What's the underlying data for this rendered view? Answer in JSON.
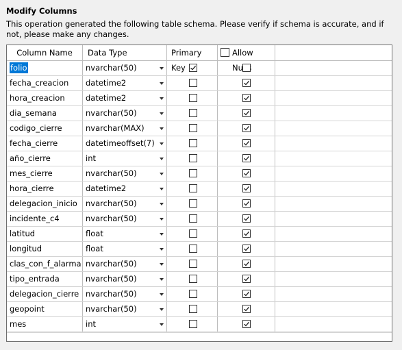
{
  "dialog": {
    "title": "Modify Columns",
    "description": "This operation generated the following table schema. Please verify if schema is accurate, and if not, please make any changes."
  },
  "grid": {
    "headers": {
      "column_name": "Column Name",
      "data_type": "Data Type",
      "primary_key": "Primary Key",
      "allow_nulls": "Allow Nulls"
    },
    "allow_nulls_header_checked": false,
    "rows": [
      {
        "name": "folio",
        "type": "nvarchar(50)",
        "primary_key": true,
        "allow_nulls": false
      },
      {
        "name": "fecha_creacion",
        "type": "datetime2",
        "primary_key": false,
        "allow_nulls": true
      },
      {
        "name": "hora_creacion",
        "type": "datetime2",
        "primary_key": false,
        "allow_nulls": true
      },
      {
        "name": "dia_semana",
        "type": "nvarchar(50)",
        "primary_key": false,
        "allow_nulls": true
      },
      {
        "name": "codigo_cierre",
        "type": "nvarchar(MAX)",
        "primary_key": false,
        "allow_nulls": true
      },
      {
        "name": "fecha_cierre",
        "type": "datetimeoffset(7)",
        "primary_key": false,
        "allow_nulls": true
      },
      {
        "name": "año_cierre",
        "type": "int",
        "primary_key": false,
        "allow_nulls": true
      },
      {
        "name": "mes_cierre",
        "type": "nvarchar(50)",
        "primary_key": false,
        "allow_nulls": true
      },
      {
        "name": "hora_cierre",
        "type": "datetime2",
        "primary_key": false,
        "allow_nulls": true
      },
      {
        "name": "delegacion_inicio",
        "type": "nvarchar(50)",
        "primary_key": false,
        "allow_nulls": true
      },
      {
        "name": "incidente_c4",
        "type": "nvarchar(50)",
        "primary_key": false,
        "allow_nulls": true
      },
      {
        "name": "latitud",
        "type": "float",
        "primary_key": false,
        "allow_nulls": true
      },
      {
        "name": "longitud",
        "type": "float",
        "primary_key": false,
        "allow_nulls": true
      },
      {
        "name": "clas_con_f_alarma",
        "type": "nvarchar(50)",
        "primary_key": false,
        "allow_nulls": true
      },
      {
        "name": "tipo_entrada",
        "type": "nvarchar(50)",
        "primary_key": false,
        "allow_nulls": true
      },
      {
        "name": "delegacion_cierre",
        "type": "nvarchar(50)",
        "primary_key": false,
        "allow_nulls": true
      },
      {
        "name": "geopoint",
        "type": "nvarchar(50)",
        "primary_key": false,
        "allow_nulls": true
      },
      {
        "name": "mes",
        "type": "int",
        "primary_key": false,
        "allow_nulls": true
      }
    ]
  },
  "icons": {
    "dropdown": "chevron-down-icon",
    "check": "checkmark-icon"
  },
  "colors": {
    "selection": "#0078d7",
    "border": "#6e6e6e"
  }
}
